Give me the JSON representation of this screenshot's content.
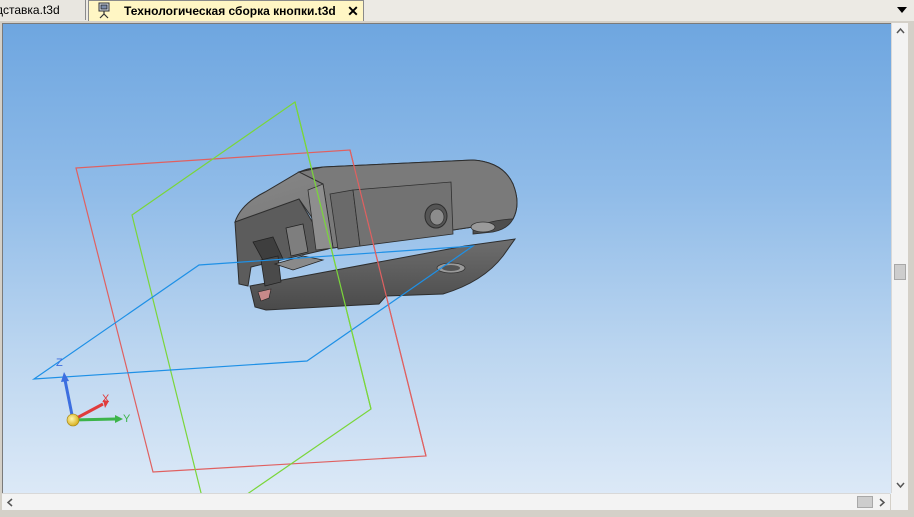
{
  "tabs": [
    {
      "label": "дставка.t3d",
      "active": false
    },
    {
      "label": "Технологическая сборка кнопки.t3d",
      "active": true
    }
  ],
  "tab_close_glyph": "✕",
  "icons": {
    "tab_document": "assembly-document-icon",
    "overflow": "chevron-down-icon",
    "scroll_up": "arrow-up-icon",
    "scroll_down": "arrow-down-icon",
    "scroll_left": "arrow-left-icon",
    "scroll_right": "arrow-right-icon"
  },
  "axes": {
    "z": "Z",
    "x": "X",
    "y": "Y"
  },
  "colors": {
    "plane_xy": "#1e90e6",
    "plane_zx": "#e05050",
    "plane_zy": "#7ad63a",
    "axis_x": "#e03c3c",
    "axis_y": "#3cb44a",
    "axis_z": "#3c6ee0",
    "model": "#666666",
    "tab_active": "#fff6c4"
  }
}
